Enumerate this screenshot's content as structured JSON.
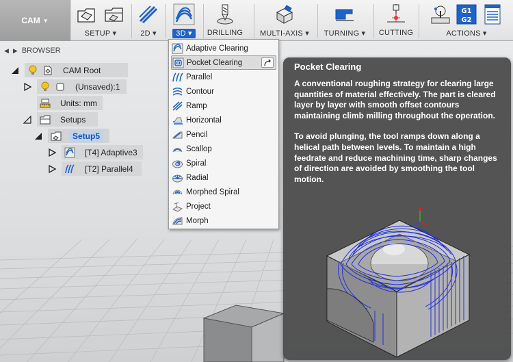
{
  "toolbar": {
    "workspace": "CAM",
    "groups": {
      "setup": "SETUP",
      "g2d": "2D",
      "g3d": "3D",
      "drilling": "DRILLING",
      "multiaxis": "MULTI-AXIS",
      "turning": "TURNING",
      "cutting": "CUTTING",
      "actions": "ACTIONS"
    },
    "actions_g_codes": [
      "G1",
      "G2"
    ],
    "accent": "#1d63c9"
  },
  "browser": {
    "title": "BROWSER",
    "nodes": [
      {
        "label": "CAM Root"
      },
      {
        "label": "(Unsaved):1"
      },
      {
        "label": "Units: mm"
      },
      {
        "label": "Setups"
      },
      {
        "label": "Setup5"
      },
      {
        "label": "[T4] Adaptive3"
      },
      {
        "label": "[T2] Parallel4"
      }
    ]
  },
  "menu": {
    "items": [
      {
        "label": "Adaptive Clearing",
        "icon": "adaptive-clearing-icon"
      },
      {
        "label": "Pocket Clearing",
        "icon": "pocket-clearing-icon"
      },
      {
        "label": "Parallel",
        "icon": "parallel-icon"
      },
      {
        "label": "Contour",
        "icon": "contour-icon"
      },
      {
        "label": "Ramp",
        "icon": "ramp-icon"
      },
      {
        "label": "Horizontal",
        "icon": "horizontal-icon"
      },
      {
        "label": "Pencil",
        "icon": "pencil-icon"
      },
      {
        "label": "Scallop",
        "icon": "scallop-icon"
      },
      {
        "label": "Spiral",
        "icon": "spiral-icon"
      },
      {
        "label": "Radial",
        "icon": "radial-icon"
      },
      {
        "label": "Morphed Spiral",
        "icon": "morphed-spiral-icon"
      },
      {
        "label": "Project",
        "icon": "project-icon"
      },
      {
        "label": "Morph",
        "icon": "morph-icon"
      }
    ]
  },
  "tooltip": {
    "title": "Pocket Clearing",
    "paragraph1": "A conventional roughing strategy for clearing large quantities of material effectively. The part is cleared layer by layer with smooth offset contours maintaining climb milling throughout the operation.",
    "paragraph2": "To avoid plunging, the tool ramps down along a helical path between levels. To maintain a high feedrate and reduce machining time, sharp changes of direction are avoided by smoothing the tool motion."
  }
}
